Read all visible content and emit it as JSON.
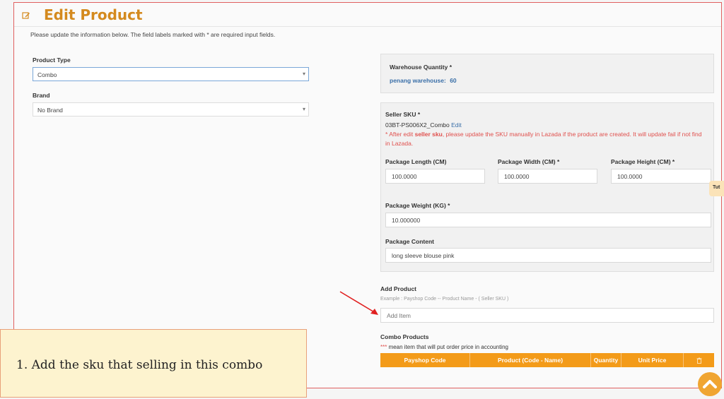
{
  "header": {
    "title": "Edit Product",
    "icon": "edit-icon"
  },
  "intro": "Please update the information below. The field labels marked with * are required input fields.",
  "product_type": {
    "label": "Product Type",
    "value": "Combo"
  },
  "brand": {
    "label": "Brand",
    "value": "No Brand"
  },
  "warehouse": {
    "label": "Warehouse Quantity *",
    "entry": "penang warehouse:",
    "qty": "60"
  },
  "seller_sku": {
    "label": "Seller SKU *",
    "value": "03BT-PS006X2_Combo",
    "edit": "Edit",
    "warn_prefix": "* After edit ",
    "warn_bold": "seller sku",
    "warn_rest": ", please update the SKU manually in Lazada if the product are created. It will update fail if not find in Lazada."
  },
  "package": {
    "length_label": "Package Length (CM)",
    "length": "100.0000",
    "width_label": "Package Width (CM) *",
    "width": "100.0000",
    "height_label": "Package Height (CM) *",
    "height": "100.0000",
    "weight_label": "Package Weight (KG) *",
    "weight": "10.000000",
    "content_label": "Package Content",
    "content": "long sleeve blouse pink"
  },
  "add_product": {
    "label": "Add Product",
    "example": "Example : Payshop Code -- Product Name - ( Seller SKU )",
    "placeholder": "Add Item"
  },
  "combo": {
    "label": "Combo Products",
    "note_star": "***",
    "note": " mean item that will put order price in accounting",
    "columns": [
      "Payshop Code",
      "Product (Code - Name)",
      "Quantity",
      "Unit Price"
    ],
    "delete_icon": "trash-icon"
  },
  "side_tab": "Tut",
  "callout": "1. Add the sku that selling in this combo",
  "colors": {
    "accent": "#d48a1e",
    "table_header": "#f39b19",
    "warning": "#e0504d",
    "link": "#3a6fa8"
  }
}
